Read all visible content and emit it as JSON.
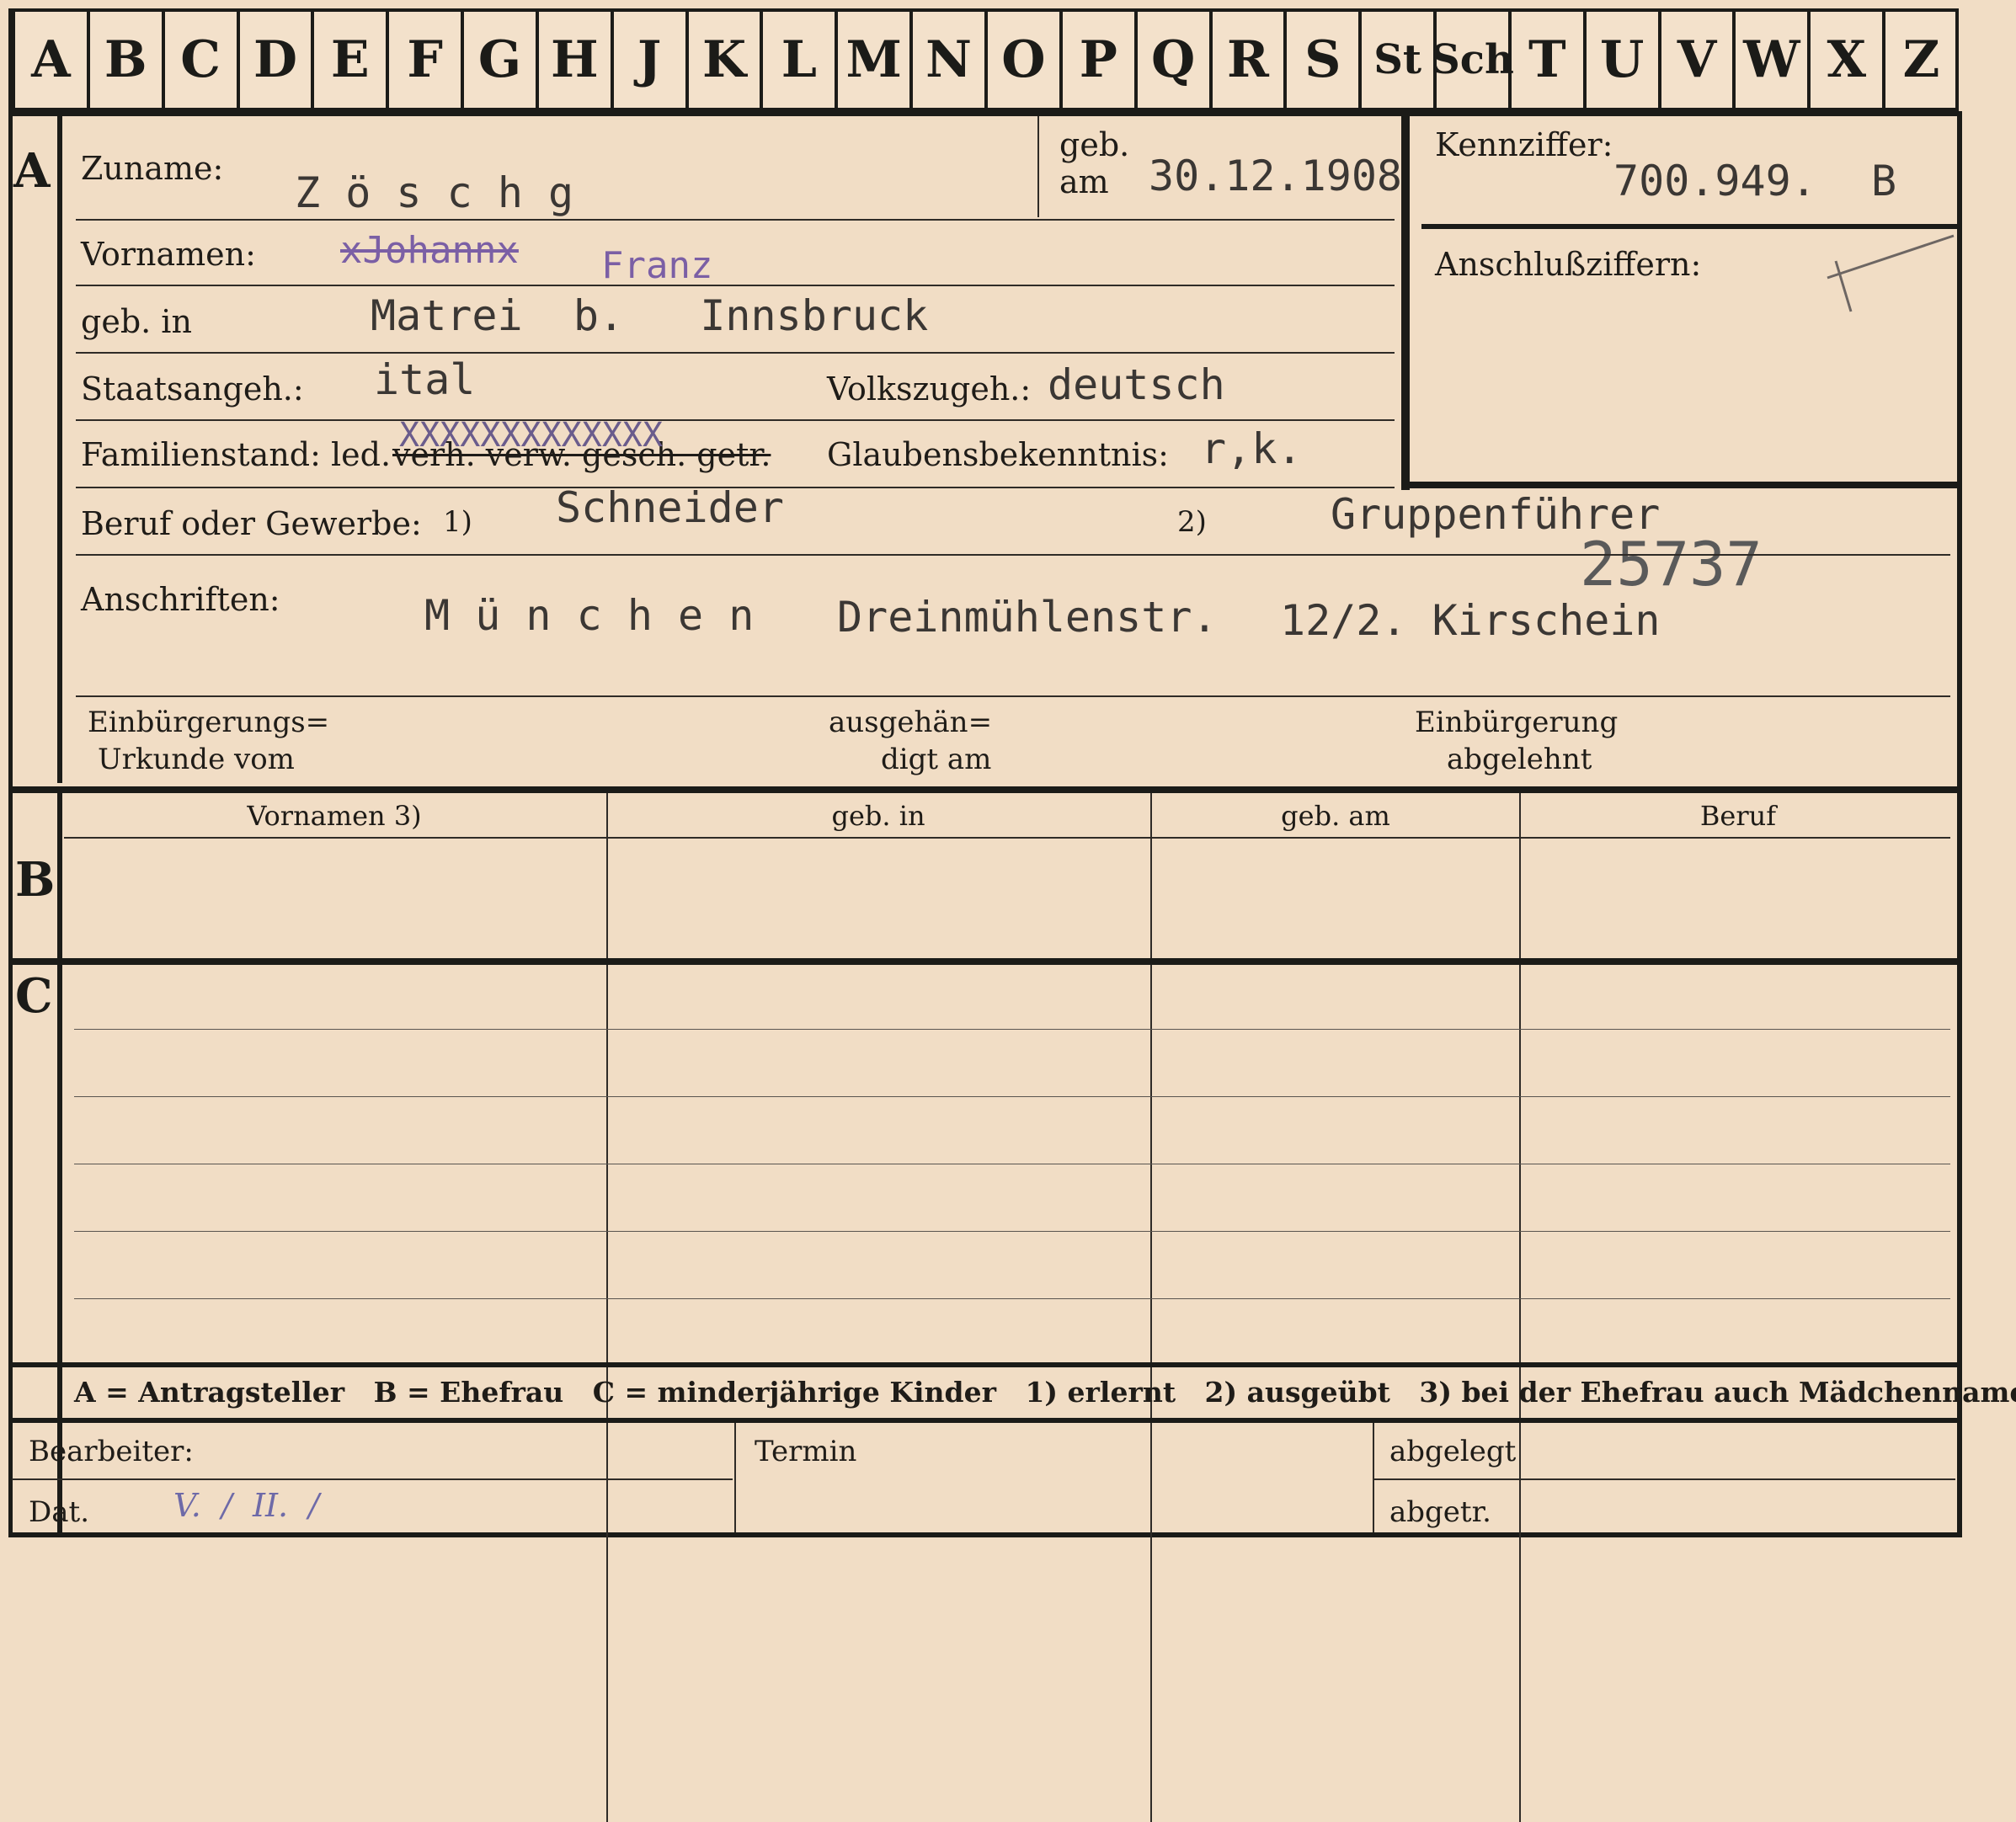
{
  "tabs": [
    "A",
    "B",
    "C",
    "D",
    "E",
    "F",
    "G",
    "H",
    "J",
    "K",
    "L",
    "M",
    "N",
    "O",
    "P",
    "Q",
    "R",
    "S",
    "St",
    "Sch",
    "T",
    "U",
    "V",
    "W",
    "X",
    "Z"
  ],
  "section_a": {
    "letter": "A",
    "zuname_label": "Zuname:",
    "zuname_value": "Z ö s c h g",
    "geb_label_1": "geb.",
    "geb_label_2": "am",
    "geb_am_value": "30.12.1908",
    "vornamen_label": "Vornamen:",
    "vornamen_struck": "xJohannx",
    "vornamen_value": "Franz",
    "geb_in_label": "geb. in",
    "geb_in_value": "Matrei  b.   Innsbruck",
    "staatsangeh_label": "Staatsangeh.:",
    "staatsangeh_value": "ital",
    "volkszugeh_label": "Volkszugeh.:",
    "volkszugeh_value": "deutsch",
    "familienstand_label": "Familienstand: led.",
    "familienstand_options": "verh. verw. gesch. getr.",
    "familienstand_overtype": "XXXXXXXXXXXXX",
    "glaubens_label": "Glaubensbekenntnis:",
    "glaubens_value": "r,k.",
    "beruf_label": "Beruf oder Gewerbe:",
    "beruf_footnote_1": "1)",
    "beruf_value": "Schneider",
    "beruf_footnote_2": "2)",
    "beruf_ausgeuebt_value": "Gruppenführer",
    "stamp_number": "25737",
    "anschriften_label": "Anschriften:",
    "anschrift_city": "M ü n c h e n",
    "anschrift_street": "Dreinmühlenstr.",
    "anschrift_nr": "12/2. Kirschein",
    "einbuergerung_urkunde_1": "Einbürgerungs=",
    "einbuergerung_urkunde_2": "Urkunde vom",
    "ausgehaendigt_1": "ausgehän=",
    "ausgehaendigt_2": "digt am",
    "einbuergerung_abgelehnt_1": "Einbürgerung",
    "einbuergerung_abgelehnt_2": "abgelehnt"
  },
  "kennziffer": {
    "label": "Kennziffer:",
    "value": "700.949.",
    "suffix": "B",
    "anschluss_label": "Anschlußziffern:"
  },
  "section_b": {
    "letter": "B",
    "headers": [
      "Vornamen 3)",
      "geb. in",
      "geb. am",
      "Beruf"
    ]
  },
  "section_c": {
    "letter": "C"
  },
  "legend": {
    "text": "A = Antragsteller   B = Ehefrau   C = minderjährige Kinder   1) erlernt   2) ausgeübt   3) bei der Ehefrau auch Mädchenname"
  },
  "footer": {
    "bearbeiter_label": "Bearbeiter:",
    "dat_label": "Dat.",
    "dat_value": "V.  /  II.  /",
    "termin_label": "Termin",
    "abgelegt_label": "abgelegt",
    "abgetr_label": "abgetr."
  },
  "colors": {
    "paper": "#f1ddc5",
    "ink": "#1b1b18",
    "violet": "#7b5fa5",
    "typewriter": "#3b3734"
  }
}
